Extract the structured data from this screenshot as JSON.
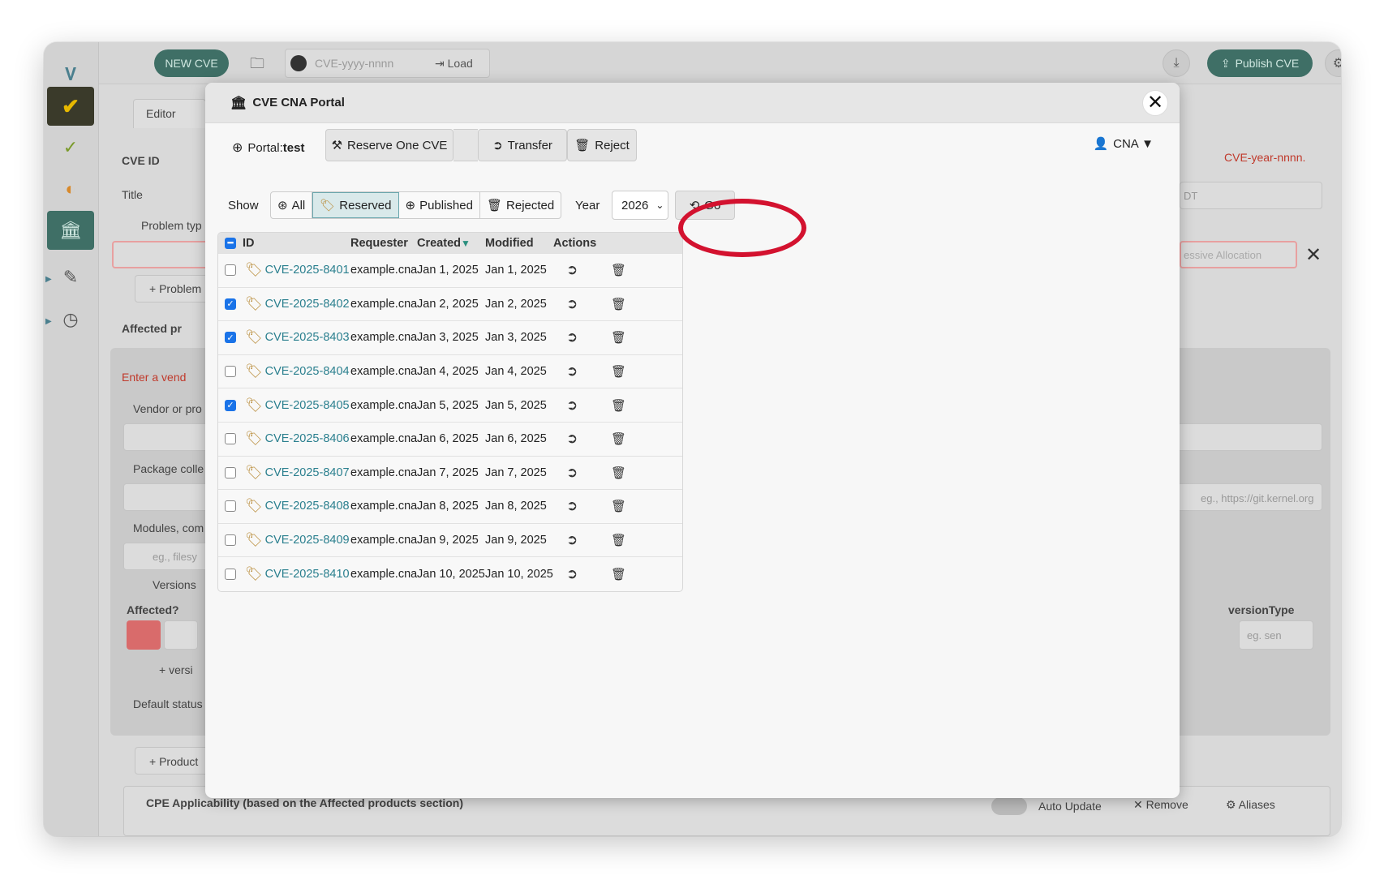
{
  "app": {
    "new_cve": "NEW CVE",
    "cve_input_placeholder": "CVE-yyyy-nnnn",
    "load": "Load",
    "publish": "Publish CVE"
  },
  "background": {
    "editor_tab": "Editor",
    "cve_id_label": "CVE ID",
    "title_label": "Title",
    "problem_types": "Problem typ",
    "add_problem": "Problem",
    "affected": "Affected pr",
    "enter_vendor": "Enter a vend",
    "vendor_or_product": "Vendor or pro",
    "package_collection": "Package colle",
    "modules": "Modules, com",
    "modules_placeholder": "eg., filesy",
    "versions": "Versions",
    "affected_q": "Affected?",
    "add_version": "versi",
    "default_status": "Default status",
    "add_product": "Product",
    "cpe": "CPE Applicability (based on the Affected products section)",
    "right_cve": "CVE-year-nnnn.",
    "right_dt": "DT",
    "right_allocation": "essive Allocation",
    "right_repo_placeholder": "eg., https://git.kernel.org",
    "version_type": "versionType",
    "version_type_placeholder": "eg. sen",
    "auto_update": "Auto Update",
    "remove": "Remove",
    "aliases": "Aliases"
  },
  "modal": {
    "title": "CVE CNA Portal",
    "portal_label": "Portal:",
    "portal_value": "test",
    "reserve": "Reserve One CVE",
    "transfer": "Transfer",
    "reject": "Reject",
    "cna": "CNA ▼",
    "show_label": "Show",
    "filters": [
      "All",
      "Reserved",
      "Published",
      "Rejected"
    ],
    "active_filter": "Reserved",
    "year_label": "Year",
    "year_value": "2026",
    "go": "Go",
    "columns": [
      "ID",
      "Requester",
      "Created",
      "Modified",
      "Actions"
    ],
    "sort_indicator": "▼",
    "rows": [
      {
        "id": "CVE-2025-8401",
        "requester": "example.cna",
        "created": "Jan 1, 2025",
        "modified": "Jan 1, 2025",
        "checked": false
      },
      {
        "id": "CVE-2025-8402",
        "requester": "example.cna",
        "created": "Jan 2, 2025",
        "modified": "Jan 2, 2025",
        "checked": true
      },
      {
        "id": "CVE-2025-8403",
        "requester": "example.cna",
        "created": "Jan 3, 2025",
        "modified": "Jan 3, 2025",
        "checked": true
      },
      {
        "id": "CVE-2025-8404",
        "requester": "example.cna",
        "created": "Jan 4, 2025",
        "modified": "Jan 4, 2025",
        "checked": false
      },
      {
        "id": "CVE-2025-8405",
        "requester": "example.cna",
        "created": "Jan 5, 2025",
        "modified": "Jan 5, 2025",
        "checked": true
      },
      {
        "id": "CVE-2025-8406",
        "requester": "example.cna",
        "created": "Jan 6, 2025",
        "modified": "Jan 6, 2025",
        "checked": false
      },
      {
        "id": "CVE-2025-8407",
        "requester": "example.cna",
        "created": "Jan 7, 2025",
        "modified": "Jan 7, 2025",
        "checked": false
      },
      {
        "id": "CVE-2025-8408",
        "requester": "example.cna",
        "created": "Jan 8, 2025",
        "modified": "Jan 8, 2025",
        "checked": false
      },
      {
        "id": "CVE-2025-8409",
        "requester": "example.cna",
        "created": "Jan 9, 2025",
        "modified": "Jan 9, 2025",
        "checked": false
      },
      {
        "id": "CVE-2025-8410",
        "requester": "example.cna",
        "created": "Jan 10, 2025",
        "modified": "Jan 10, 2025",
        "checked": false
      }
    ]
  },
  "colors": {
    "accent": "#3f6f66",
    "link": "#2a7f8e",
    "highlight_ring": "#d3122f",
    "checkbox": "#1a73e8"
  }
}
